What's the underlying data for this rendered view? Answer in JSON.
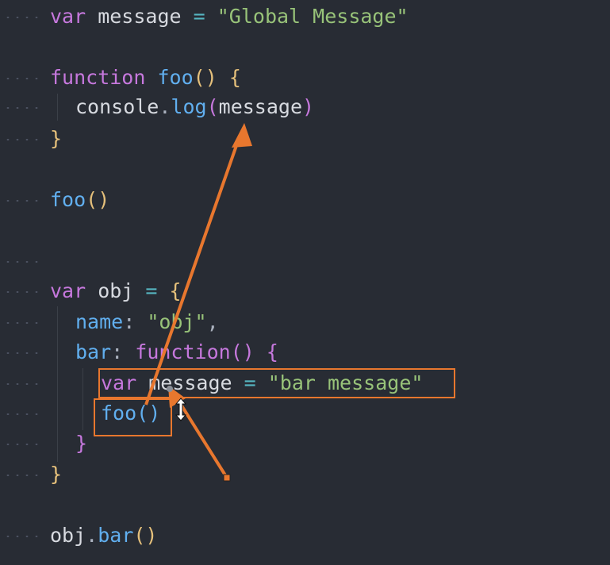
{
  "editor": {
    "lines": [
      {
        "id": "l1",
        "tokens": [
          {
            "t": "var",
            "c": "kw"
          },
          {
            "t": " message ",
            "c": "id"
          },
          {
            "t": "=",
            "c": "op"
          },
          {
            "t": " ",
            "c": "id"
          },
          {
            "t": "\"Global Message\"",
            "c": "str"
          }
        ]
      },
      {
        "id": "l2",
        "tokens": [
          {
            "t": "function",
            "c": "kw"
          },
          {
            "t": " ",
            "c": "id"
          },
          {
            "t": "foo",
            "c": "fn"
          },
          {
            "t": "()",
            "c": "br1"
          },
          {
            "t": " ",
            "c": "id"
          },
          {
            "t": "{",
            "c": "br1"
          }
        ]
      },
      {
        "id": "l3",
        "tokens": [
          {
            "t": "console",
            "c": "id"
          },
          {
            "t": ".",
            "c": "punc"
          },
          {
            "t": "log",
            "c": "fn"
          },
          {
            "t": "(",
            "c": "br2"
          },
          {
            "t": "message",
            "c": "id"
          },
          {
            "t": ")",
            "c": "br2"
          }
        ]
      },
      {
        "id": "l4",
        "tokens": [
          {
            "t": "}",
            "c": "br1"
          }
        ]
      },
      {
        "id": "l5",
        "tokens": [
          {
            "t": "foo",
            "c": "fn"
          },
          {
            "t": "()",
            "c": "br1"
          }
        ]
      },
      {
        "id": "l6",
        "tokens": [
          {
            "t": "var",
            "c": "kw"
          },
          {
            "t": " obj ",
            "c": "id"
          },
          {
            "t": "=",
            "c": "op"
          },
          {
            "t": " ",
            "c": "id"
          },
          {
            "t": "{",
            "c": "br1"
          }
        ]
      },
      {
        "id": "l7",
        "tokens": [
          {
            "t": "name",
            "c": "prop"
          },
          {
            "t": ": ",
            "c": "punc"
          },
          {
            "t": "\"obj\"",
            "c": "str"
          },
          {
            "t": ",",
            "c": "punc"
          }
        ]
      },
      {
        "id": "l8",
        "tokens": [
          {
            "t": "bar",
            "c": "prop"
          },
          {
            "t": ": ",
            "c": "punc"
          },
          {
            "t": "function",
            "c": "kw"
          },
          {
            "t": "()",
            "c": "br2"
          },
          {
            "t": " ",
            "c": "id"
          },
          {
            "t": "{",
            "c": "br2"
          }
        ]
      },
      {
        "id": "l9",
        "tokens": [
          {
            "t": "var",
            "c": "kw"
          },
          {
            "t": " message ",
            "c": "id"
          },
          {
            "t": "=",
            "c": "op"
          },
          {
            "t": " ",
            "c": "id"
          },
          {
            "t": "\"bar message\"",
            "c": "str"
          }
        ]
      },
      {
        "id": "l10",
        "tokens": [
          {
            "t": "foo",
            "c": "fn"
          },
          {
            "t": "()",
            "c": "br3"
          }
        ]
      },
      {
        "id": "l11",
        "tokens": [
          {
            "t": "}",
            "c": "br2"
          }
        ]
      },
      {
        "id": "l12",
        "tokens": [
          {
            "t": "}",
            "c": "br1"
          }
        ]
      },
      {
        "id": "l13",
        "tokens": [
          {
            "t": "obj",
            "c": "id"
          },
          {
            "t": ".",
            "c": "punc"
          },
          {
            "t": "bar",
            "c": "fn"
          },
          {
            "t": "()",
            "c": "br1"
          }
        ]
      }
    ]
  },
  "annotations": {
    "color": "#e8772e",
    "highlights": [
      "var-message-bar-line",
      "foo-call-in-bar"
    ],
    "arrows": [
      "foo-call-to-console-log-message",
      "cursor-to-foo-call"
    ]
  }
}
